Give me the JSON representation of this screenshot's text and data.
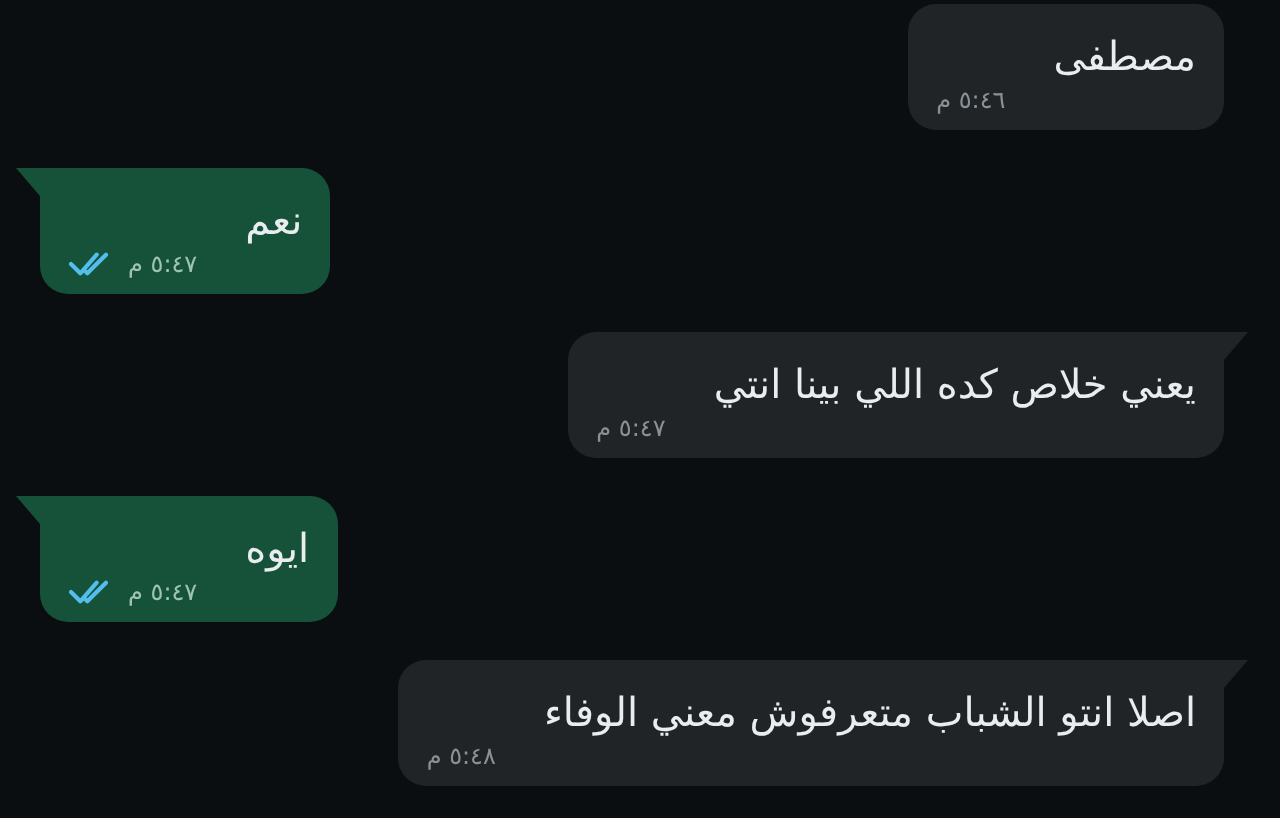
{
  "messages": [
    {
      "outgoing": false,
      "text": "مصطفى",
      "time": "٥:٤٦ م",
      "tail": false
    },
    {
      "outgoing": true,
      "text": "نعم",
      "time": "٥:٤٧ م",
      "tail": true,
      "read": true
    },
    {
      "outgoing": false,
      "text": "يعني خلاص كده اللي بينا انتي",
      "time": "٥:٤٧ م",
      "tail": true
    },
    {
      "outgoing": true,
      "text": "ايوه",
      "time": "٥:٤٧ م",
      "tail": true,
      "read": true
    },
    {
      "outgoing": false,
      "text": "اصلا انتو الشباب متعرفوش معني الوفاء",
      "time": "٥:٤٨ م",
      "tail": true
    }
  ]
}
